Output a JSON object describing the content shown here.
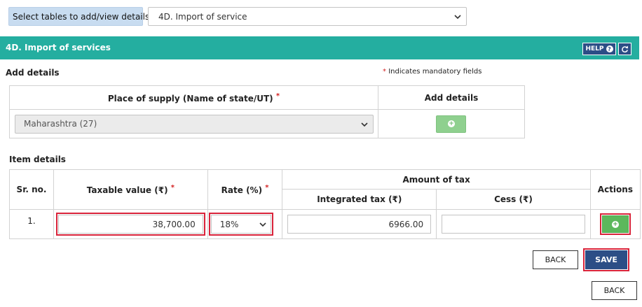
{
  "top": {
    "select_tables_label": "Select tables to add/view details",
    "table_select_value": "4D. Import of service"
  },
  "section": {
    "title": "4D. Import of services",
    "help_label": "HELP",
    "help_icon": "question-circle-icon",
    "refresh_icon": "refresh-icon"
  },
  "add_details": {
    "heading": "Add details",
    "mandatory_star": "*",
    "mandatory_note": "Indicates mandatory fields",
    "col_place": "Place of supply (Name of state/UT)",
    "col_add": "Add details",
    "place_value": "Maharashtra (27)"
  },
  "item_details": {
    "heading": "Item details",
    "headers": {
      "sr": "Sr. no.",
      "taxable": "Taxable value (₹)",
      "rate": "Rate (%)",
      "amount_of_tax": "Amount of tax",
      "integrated": "Integrated tax (₹)",
      "cess": "Cess (₹)",
      "actions": "Actions"
    },
    "row": {
      "sr": "1.",
      "taxable_value": "38,700.00",
      "rate": "18%",
      "integrated_tax": "6966.00",
      "cess": ""
    }
  },
  "buttons": {
    "back": "BACK",
    "save": "SAVE",
    "back_bottom": "BACK"
  },
  "colors": {
    "section_header": "#24aea0",
    "primary": "#2c4e86",
    "highlight": "#d9233a",
    "add_green": "#5cb85c"
  }
}
